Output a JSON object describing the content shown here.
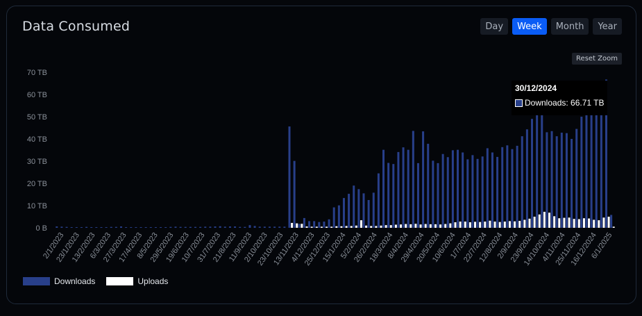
{
  "card": {
    "title": "Data Consumed"
  },
  "controls": {
    "ranges": [
      "Day",
      "Week",
      "Month",
      "Year"
    ],
    "active_range": "Week",
    "reset_zoom": "Reset Zoom"
  },
  "tooltip": {
    "date": "30/12/2024",
    "label": "Downloads: 66.71 TB"
  },
  "colors": {
    "downloads": "#283f8a",
    "uploads": "#ffffff",
    "active_button": "#0a5cf5",
    "axis_text": "#8a9099"
  },
  "chart_data": {
    "type": "bar",
    "ylim": [
      0,
      70
    ],
    "y_ticks": [
      "0 B",
      "10 TB",
      "20 TB",
      "30 TB",
      "40 TB",
      "50 TB",
      "60 TB",
      "70 TB"
    ],
    "x_tick_labels": [
      "2/1/2023",
      "23/1/2023",
      "13/2/2023",
      "6/3/2023",
      "27/3/2023",
      "17/4/2023",
      "8/5/2023",
      "29/5/2023",
      "19/6/2023",
      "10/7/2023",
      "31/7/2023",
      "21/8/2023",
      "11/9/2023",
      "2/10/2023",
      "23/10/2023",
      "13/11/2023",
      "4/12/2023",
      "25/12/2023",
      "15/1/2024",
      "5/2/2024",
      "26/2/2024",
      "18/3/2024",
      "8/4/2024",
      "29/4/2024",
      "20/5/2024",
      "10/6/2024",
      "1/7/2024",
      "22/7/2024",
      "12/8/2024",
      "2/9/2024",
      "23/9/2024",
      "14/10/2024",
      "4/11/2024",
      "25/11/2024",
      "16/12/2024",
      "6/1/2025"
    ],
    "legend": [
      "Downloads",
      "Uploads"
    ],
    "series": [
      {
        "name": "Downloads",
        "values": [
          0.6,
          0.5,
          0.4,
          0.3,
          0.3,
          0.3,
          0.4,
          0.3,
          0.3,
          0.3,
          0.3,
          0.4,
          0.4,
          0.6,
          0.3,
          0.3,
          0.3,
          0.3,
          0.3,
          0.3,
          0.3,
          0.3,
          0.3,
          0.4,
          0.5,
          0.4,
          0.4,
          0.4,
          0.4,
          0.4,
          0.5,
          0.5,
          0.6,
          0.7,
          0.5,
          0.6,
          0.6,
          0.4,
          0.4,
          1.2,
          0.8,
          0.5,
          0.5,
          0.5,
          0.5,
          0.5,
          0.5,
          45.6,
          30.1,
          1.8,
          4.4,
          3.0,
          3.0,
          2.6,
          2.8,
          3.8,
          9.2,
          10.1,
          13.4,
          15.3,
          19.0,
          17.4,
          15.5,
          12.5,
          15.8,
          24.5,
          35.1,
          29.2,
          28.7,
          34.1,
          36.2,
          35.1,
          43.6,
          29.1,
          43.4,
          37.8,
          30.2,
          29.1,
          33.2,
          31.8,
          34.9,
          35.1,
          33.9,
          30.8,
          32.7,
          31.0,
          32.1,
          35.8,
          33.9,
          31.9,
          36.3,
          37.1,
          35.4,
          36.9,
          41.2,
          44.3,
          49.0,
          52.0,
          54.5,
          43.0,
          43.5,
          41.2,
          42.8,
          42.6,
          40.0,
          44.5,
          50.0,
          54.0,
          56.5,
          61.0,
          58.0,
          66.71,
          5.8
        ]
      },
      {
        "name": "Uploads",
        "values": [
          0,
          0,
          0,
          0,
          0,
          0,
          0,
          0,
          0,
          0,
          0,
          0,
          0,
          0,
          0,
          0,
          0,
          0,
          0,
          0,
          0,
          0,
          0,
          0,
          0,
          0,
          0,
          0,
          0,
          0,
          0,
          0,
          0,
          0,
          0,
          0,
          0,
          0,
          0,
          0,
          0,
          0,
          0,
          0,
          0,
          0,
          0,
          2.2,
          2.0,
          1.8,
          0.6,
          0.5,
          0.5,
          0.5,
          0.5,
          0.5,
          0.7,
          0.7,
          0.8,
          0.8,
          1.0,
          3.4,
          1.0,
          0.8,
          0.8,
          1.0,
          1.2,
          1.2,
          1.4,
          1.5,
          1.7,
          1.6,
          1.8,
          1.5,
          1.7,
          1.6,
          1.6,
          1.5,
          1.7,
          2.0,
          2.5,
          2.8,
          2.8,
          2.5,
          2.7,
          2.6,
          2.8,
          3.2,
          2.8,
          2.6,
          2.8,
          3.0,
          2.9,
          3.1,
          3.6,
          4.1,
          5.0,
          6.0,
          7.2,
          6.8,
          5.2,
          4.3,
          4.5,
          4.6,
          4.0,
          3.9,
          4.3,
          4.2,
          3.6,
          3.4,
          4.6,
          5.0,
          0.5
        ]
      }
    ]
  }
}
